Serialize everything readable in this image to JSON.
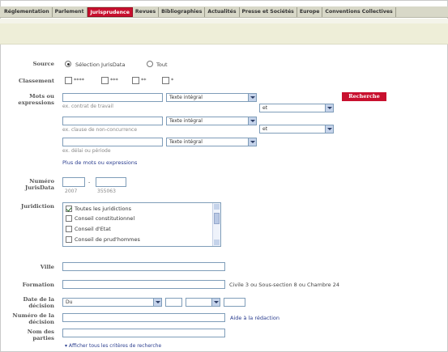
{
  "nav": {
    "tabs": [
      "Réglementation",
      "Parlement",
      "Jurisprudence",
      "Revues",
      "Bibliographies",
      "Actualités",
      "Presse et Sociétés",
      "Europe",
      "Conventions Collectives"
    ],
    "active": "Jurisprudence"
  },
  "form": {
    "source": {
      "label": "Source",
      "option1": "Sélection JurisData",
      "option2": "Tout"
    },
    "classement": {
      "label": "Classement",
      "options": [
        "****",
        "***",
        "**",
        "*"
      ]
    },
    "mots": {
      "label": "Mots ou expressions",
      "select_value": "Texte intégral",
      "operator": "et",
      "hints": [
        "ex. contrat de travail",
        "ex. clause de non-concurrence",
        "ex. délai ou période"
      ],
      "more_link": "Plus de mots ou expressions",
      "search_button": "Recherche"
    },
    "numero": {
      "label": "Numéro JurisData",
      "separator": "-",
      "hint_year": "2007",
      "hint_number": "355063"
    },
    "juridiction": {
      "label": "Juridiction",
      "items": [
        "Toutes les juridictions",
        "Conseil constitutionnel",
        "Conseil d'Etat",
        "Conseil de prud'hommes"
      ]
    },
    "ville": {
      "label": "Ville"
    },
    "formation": {
      "label": "Formation",
      "hint": "Civile 3 ou Sous-section 8 ou Chambre 24"
    },
    "date": {
      "label": "Date de la décision",
      "select_value": "Du"
    },
    "numero_decision": {
      "label": "Numéro de la décision",
      "help_link": "Aide à la rédaction"
    },
    "parties": {
      "label": "Nom des parties"
    },
    "show_all": "Afficher tous les critères de recherche"
  }
}
